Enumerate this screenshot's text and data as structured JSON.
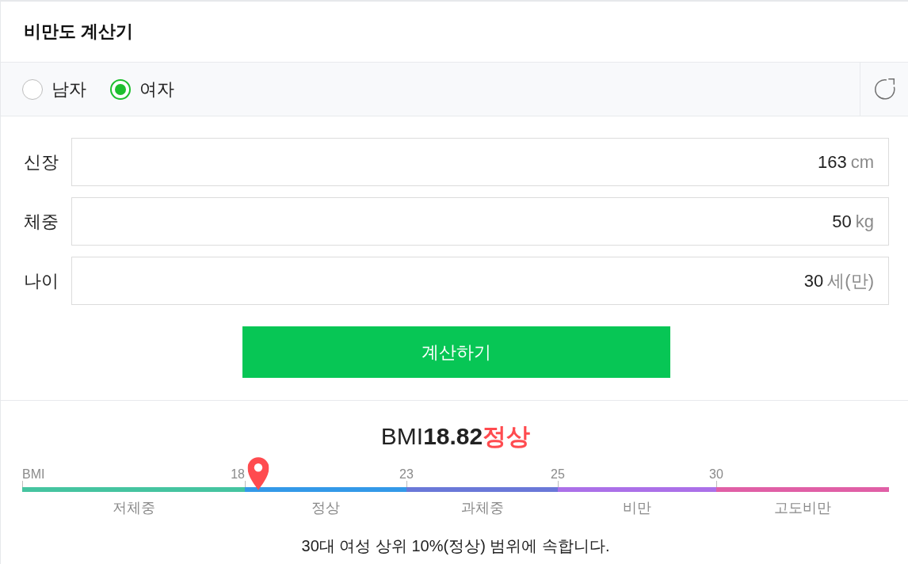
{
  "header": {
    "title": "비만도 계산기"
  },
  "gender": {
    "options": [
      {
        "label": "남자",
        "selected": false
      },
      {
        "label": "여자",
        "selected": true
      }
    ]
  },
  "fields": [
    {
      "label": "신장",
      "value": "163",
      "unit": "cm"
    },
    {
      "label": "체중",
      "value": "50",
      "unit": "kg"
    },
    {
      "label": "나이",
      "value": "30",
      "unit": "세(만)"
    }
  ],
  "calculate_button": {
    "label": "계산하기"
  },
  "result": {
    "label": "BMI",
    "value": "18.82",
    "category": "정상"
  },
  "scale": {
    "segments": [
      {
        "tick": "BMI",
        "label": "저체중",
        "color": "#45c4a0"
      },
      {
        "tick": "18",
        "label": "정상",
        "color": "#3399e8"
      },
      {
        "tick": "23",
        "label": "과체중",
        "color": "#6a78d8"
      },
      {
        "tick": "25",
        "label": "비만",
        "color": "#ab70e8"
      },
      {
        "tick": "30",
        "label": "고도비만",
        "color": "#e05fa6"
      }
    ],
    "marker": {
      "level": 0.272
    }
  },
  "message": "30대 여성 상위 10%(정상) 범위에 속합니다."
}
